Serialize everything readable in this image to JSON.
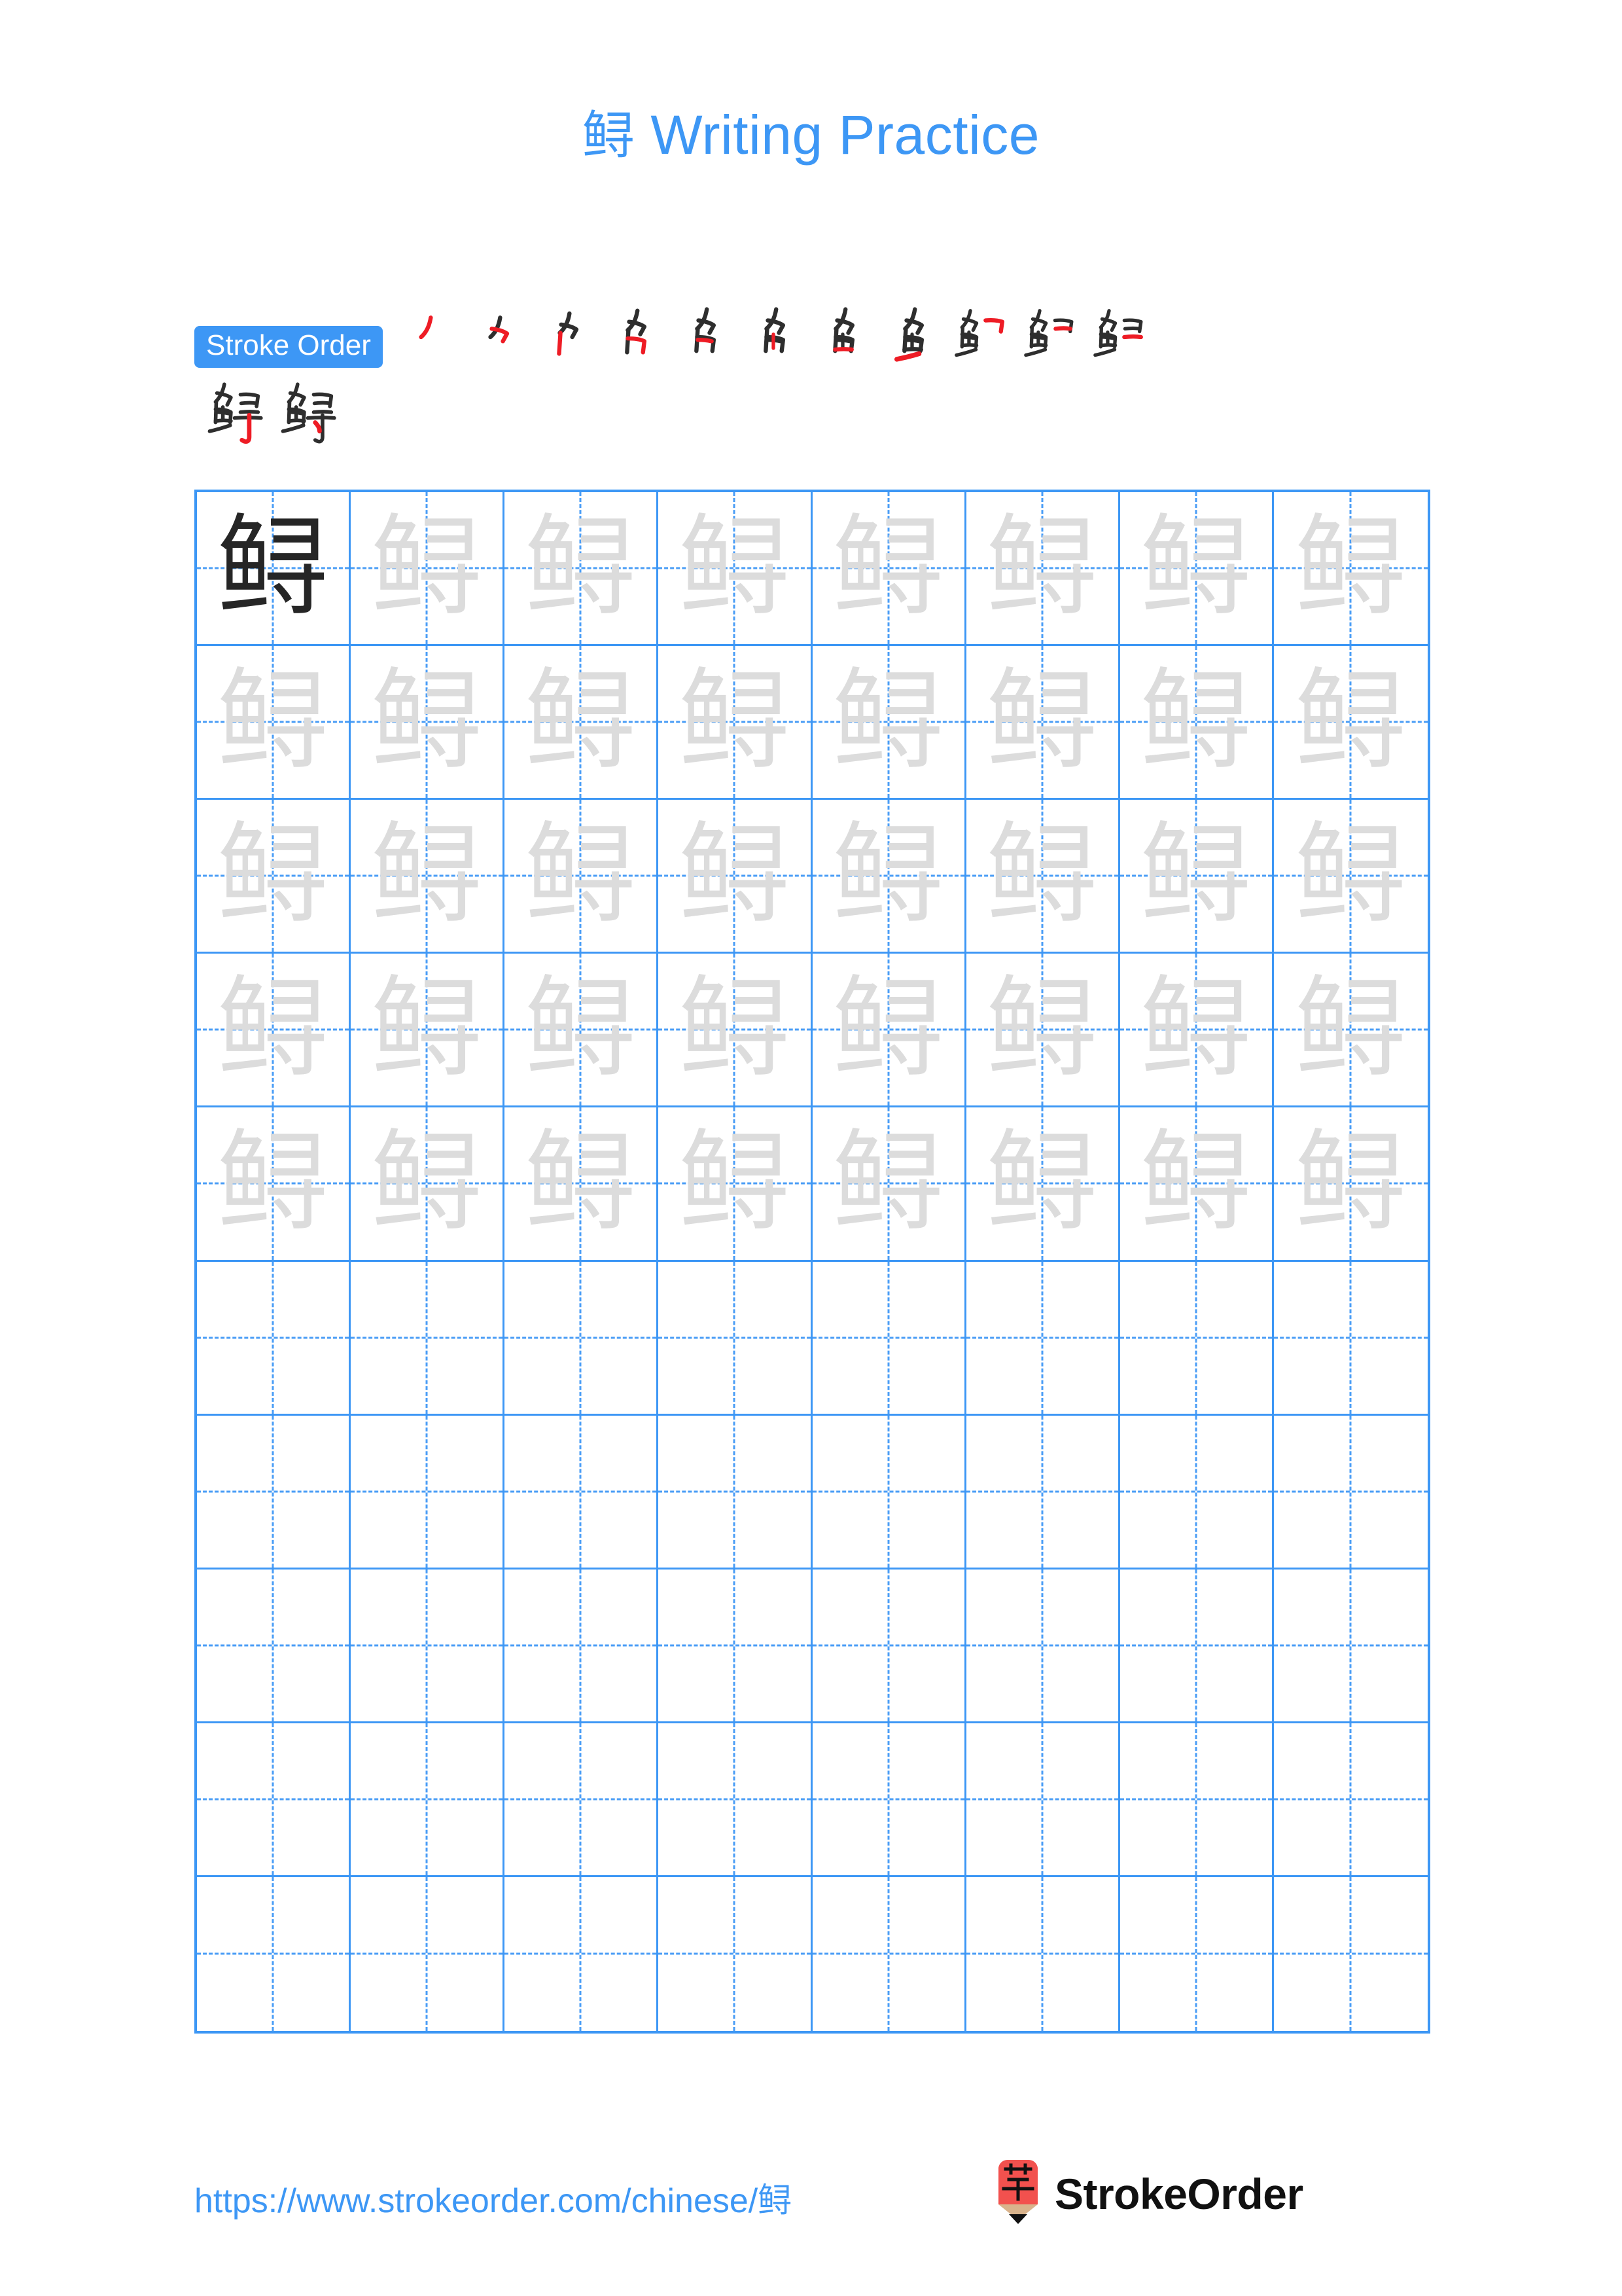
{
  "character": "鲟",
  "title": {
    "character": "鲟",
    "suffix": " Writing Practice",
    "full": "鲟 Writing Practice",
    "color": "#3D97F5"
  },
  "stroke_order": {
    "badge_label": "Stroke Order",
    "badge_bg": "#3D97F5",
    "badge_text_color": "#FFFFFF",
    "total_strokes": 13,
    "ink_color": "#2E2E2E",
    "new_stroke_color": "#EE1C25",
    "steps": [
      {
        "index": 1,
        "partial": "丿"
      },
      {
        "index": 2,
        "partial": "⺈"
      },
      {
        "index": 3,
        "partial": "⺈"
      },
      {
        "index": 4,
        "partial": "刍"
      },
      {
        "index": 5,
        "partial": "㑇"
      },
      {
        "index": 6,
        "partial": "angular"
      },
      {
        "index": 7,
        "partial": "鱼"
      },
      {
        "index": 8,
        "partial": "鱼"
      },
      {
        "index": 9,
        "partial": "鱼"
      },
      {
        "index": 10,
        "partial": "鱼"
      },
      {
        "index": 11,
        "partial": "鱼"
      },
      {
        "index": 12,
        "partial": "鲟"
      },
      {
        "index": 13,
        "partial": "鲟"
      }
    ]
  },
  "practice_grid": {
    "columns": 8,
    "rows": 10,
    "border_color": "#3D97F5",
    "guide_color": "#4A9DF6",
    "dark_glyph_color": "#262626",
    "trace_glyph_color": "#DCDCDC",
    "model_character": "鲟",
    "row_modes": [
      "model-then-trace",
      "trace",
      "trace",
      "trace",
      "trace",
      "blank",
      "blank",
      "blank",
      "blank",
      "blank"
    ]
  },
  "footer": {
    "url": "https://www.strokeorder.com/chinese/鲟",
    "url_color": "#3D97F5",
    "brand_name": "StrokeOrder",
    "logo_char": "字",
    "logo_body_color": "#F2514E",
    "logo_wood_color": "#D9B38C",
    "logo_tip_color": "#111111"
  }
}
